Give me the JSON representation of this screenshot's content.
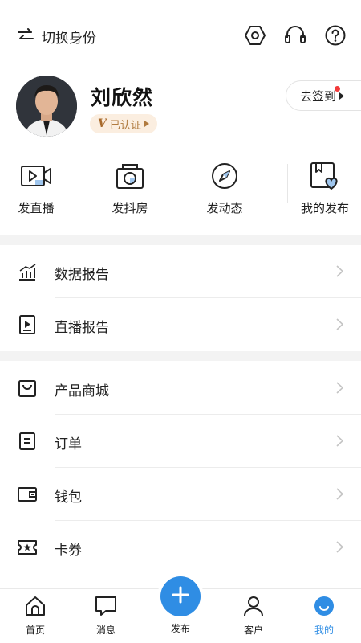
{
  "header": {
    "switch_label": "切换身份",
    "icons": [
      "switch-icon",
      "settings-icon",
      "headset-icon",
      "help-icon"
    ]
  },
  "profile": {
    "name": "刘欣然",
    "verified_label": "已认证",
    "verified_mark": "V",
    "checkin_label": "去签到"
  },
  "quick_actions": [
    {
      "label": "发直播",
      "icon": "live-video-icon"
    },
    {
      "label": "发抖房",
      "icon": "camera-icon"
    },
    {
      "label": "发动态",
      "icon": "compass-icon"
    },
    {
      "label": "我的发布",
      "icon": "bookmark-heart-icon"
    }
  ],
  "menu_group_1": [
    {
      "label": "数据报告",
      "icon": "chart-icon"
    },
    {
      "label": "直播报告",
      "icon": "play-report-icon"
    }
  ],
  "menu_group_2": [
    {
      "label": "产品商城",
      "icon": "shopping-bag-icon"
    },
    {
      "label": "订单",
      "icon": "order-icon"
    },
    {
      "label": "钱包",
      "icon": "wallet-icon"
    },
    {
      "label": "卡券",
      "icon": "coupon-icon"
    }
  ],
  "tabbar": {
    "items": [
      {
        "label": "首页",
        "icon": "home-icon"
      },
      {
        "label": "消息",
        "icon": "message-icon"
      },
      {
        "label": "发布",
        "icon": "plus-icon"
      },
      {
        "label": "客户",
        "icon": "user-icon"
      },
      {
        "label": "我的",
        "icon": "me-icon"
      }
    ],
    "active_index": 4
  },
  "colors": {
    "accent": "#2f8de4",
    "badge_bg": "#fbeee0",
    "badge_text": "#b07a3e",
    "notify_dot": "#f23a3a"
  }
}
